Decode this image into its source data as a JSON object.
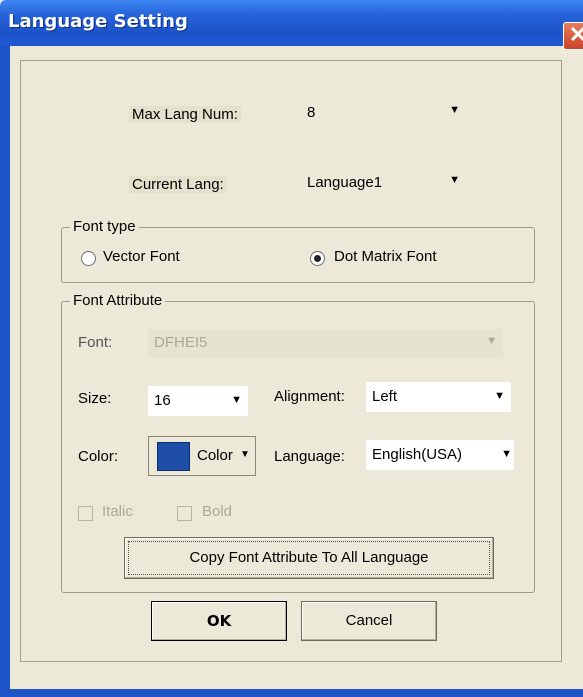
{
  "window": {
    "title": "Language Setting",
    "close_glyph": "✕"
  },
  "max_lang": {
    "label": "Max Lang Num:",
    "value": "8"
  },
  "current_lang": {
    "label": "Current Lang:",
    "value": "Language1"
  },
  "font_type": {
    "title": "Font type",
    "options": [
      {
        "label": "Vector Font",
        "selected": false
      },
      {
        "label": "Dot Matrix Font",
        "selected": true
      }
    ]
  },
  "font_attribute": {
    "title": "Font Attribute",
    "font": {
      "label": "Font:",
      "value": "DFHEI5"
    },
    "size": {
      "label": "Size:",
      "value": "16"
    },
    "alignment": {
      "label": "Alignment:",
      "value": "Left"
    },
    "color": {
      "label": "Color:",
      "button_label": "Color",
      "swatch": "#1e4ea8"
    },
    "language": {
      "label": "Language:",
      "value": "English(USA)"
    },
    "italic": {
      "label": "Italic",
      "checked": false
    },
    "bold": {
      "label": "Bold",
      "checked": false
    },
    "copy_button": "Copy Font Attribute To All Language"
  },
  "buttons": {
    "ok": "OK",
    "cancel": "Cancel"
  },
  "glyphs": {
    "dropdown": "▼"
  }
}
